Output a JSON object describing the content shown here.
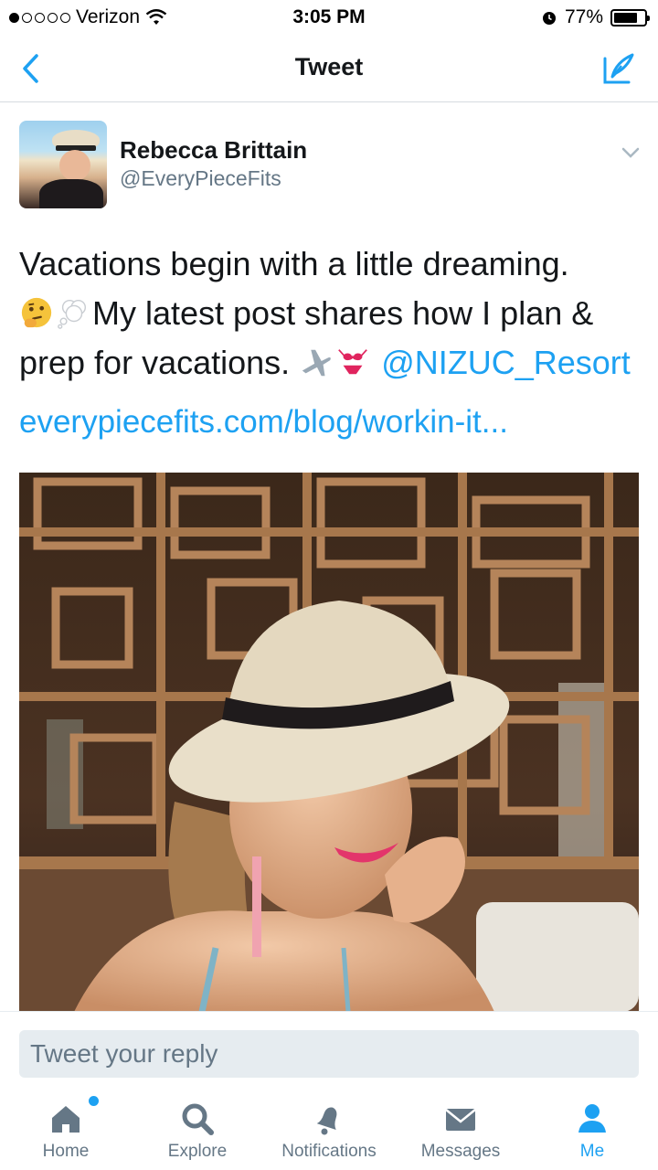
{
  "status_bar": {
    "carrier": "Verizon",
    "time": "3:05 PM",
    "battery": "77%",
    "battery_level": 0.77,
    "icons": [
      "signal-dots-icon",
      "wifi-icon",
      "alarm-icon",
      "battery-icon"
    ]
  },
  "nav": {
    "title": "Tweet",
    "back_icon": "chevron-left-icon",
    "compose_icon": "compose-icon"
  },
  "tweet": {
    "author_name": "Rebecca Brittain",
    "author_handle": "@EveryPieceFits",
    "text_line1": "Vacations begin with a little dreaming.",
    "text_line2": "My latest post shares how I plan &",
    "text_line3": "prep for vacations.",
    "mention": "@NIZUC_Resort",
    "link": "everypiecefits.com/blog/workin-it...",
    "emojis": [
      "thinking-face-emoji",
      "thought-balloon-emoji",
      "airplane-emoji",
      "bikini-emoji"
    ]
  },
  "reply": {
    "placeholder": "Tweet your reply"
  },
  "tabs": [
    {
      "label": "Home",
      "icon": "home-icon",
      "active": false
    },
    {
      "label": "Explore",
      "icon": "search-icon",
      "active": false
    },
    {
      "label": "Notifications",
      "icon": "bell-icon",
      "active": false
    },
    {
      "label": "Messages",
      "icon": "envelope-icon",
      "active": false
    },
    {
      "label": "Me",
      "icon": "person-icon",
      "active": true
    }
  ],
  "colors": {
    "accent": "#1da1f2",
    "text": "#14171a",
    "secondary": "#657786",
    "tab_inactive": "#657786"
  }
}
